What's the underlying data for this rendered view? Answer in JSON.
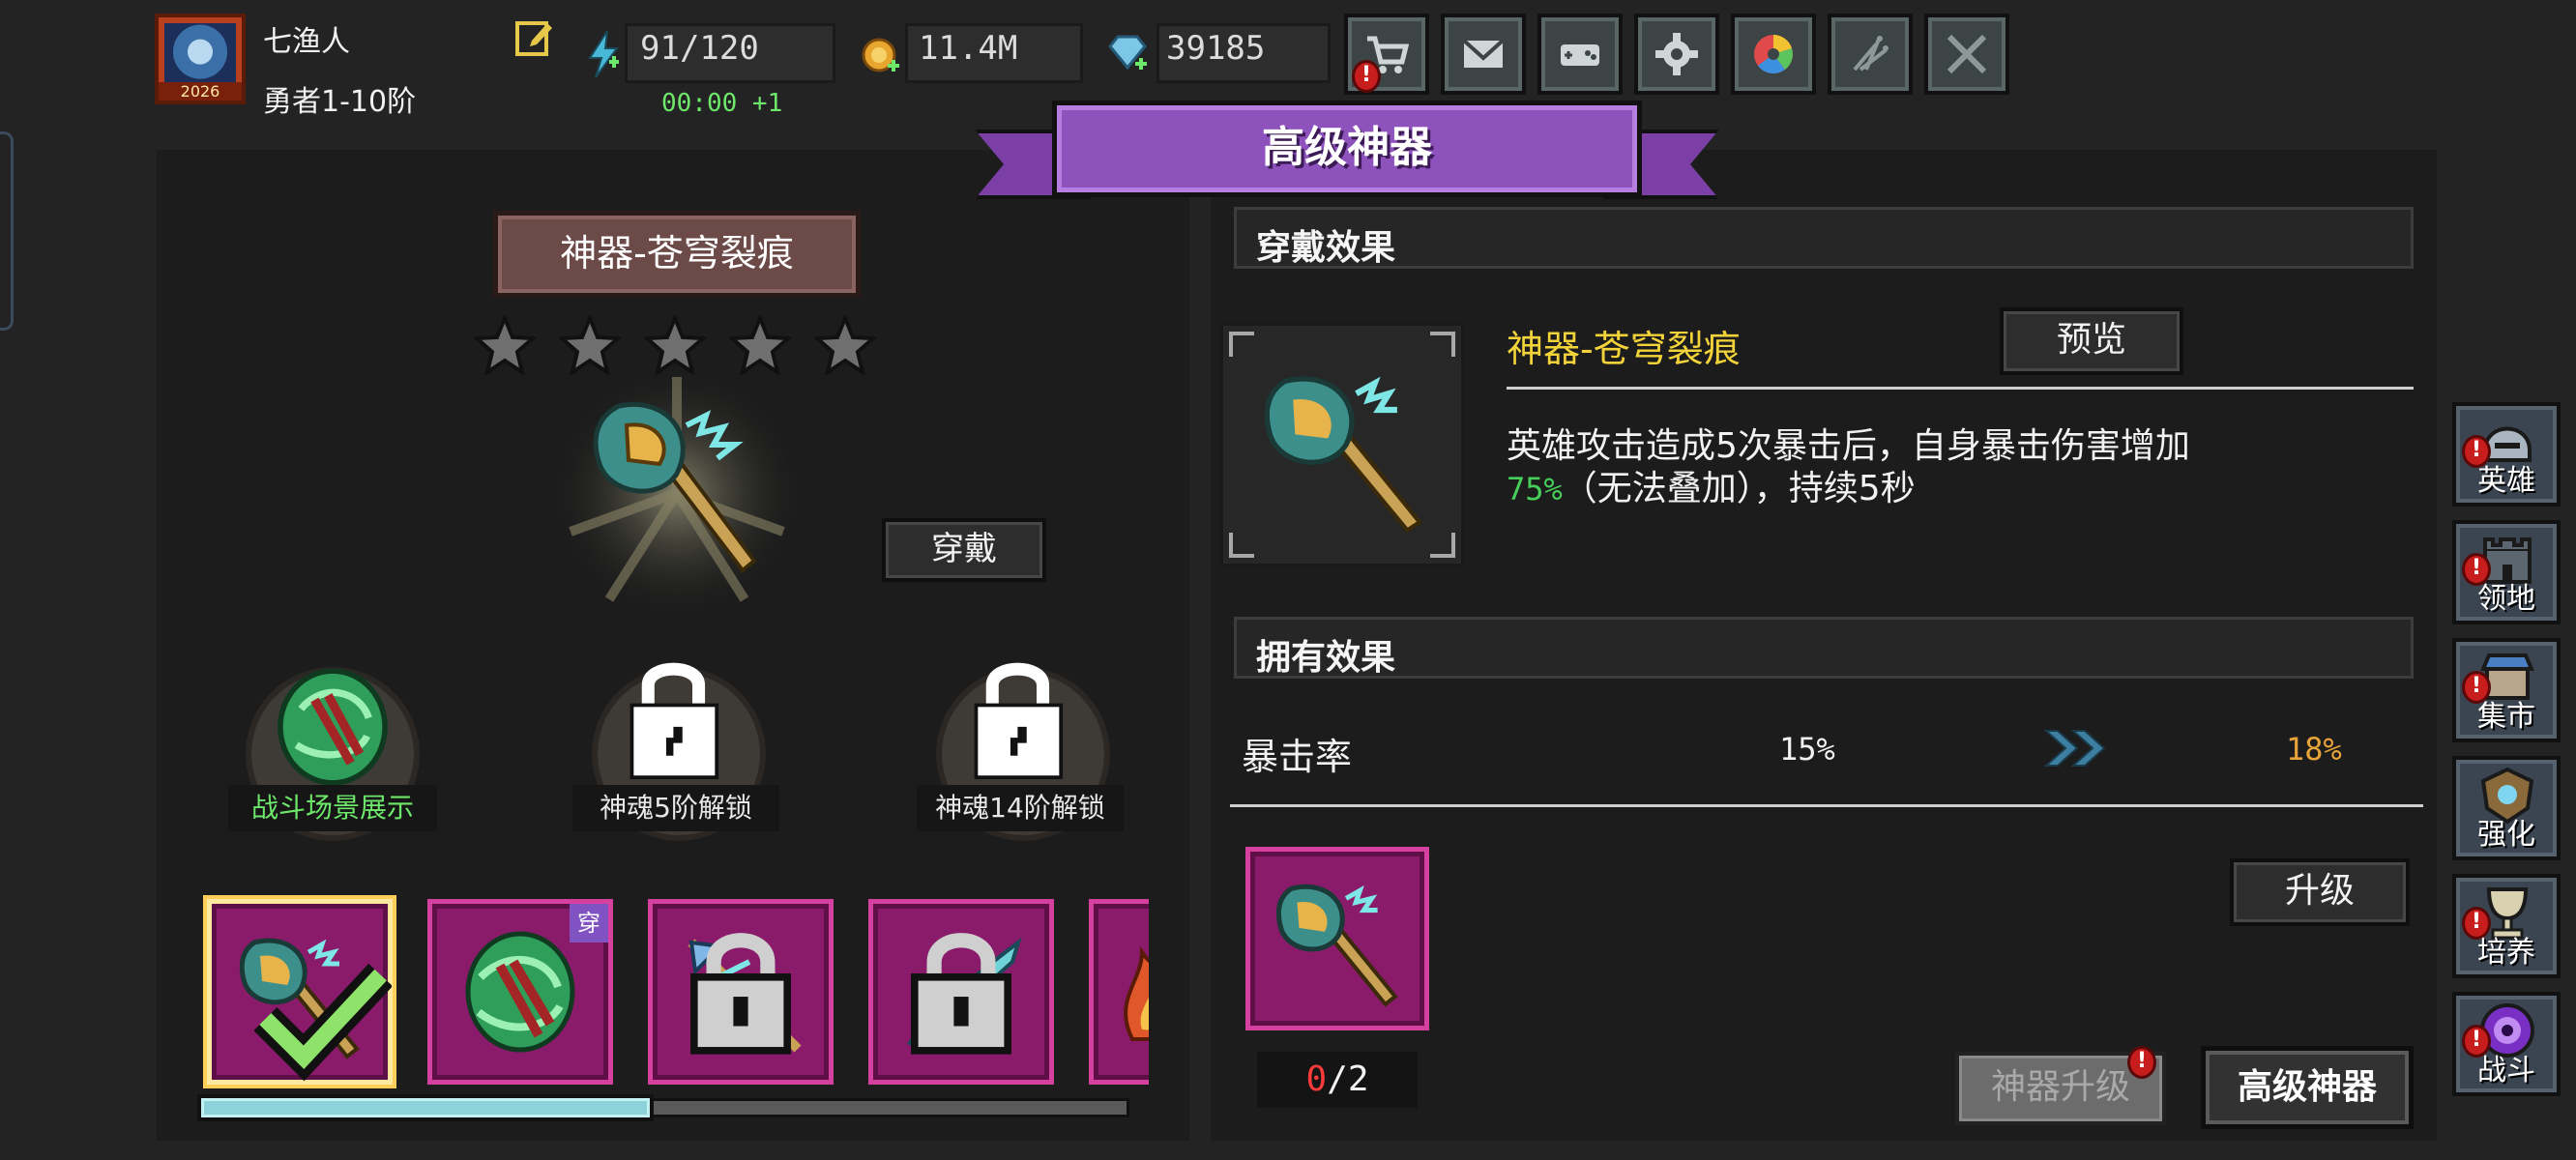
{
  "player": {
    "name": "七渔人",
    "rank": "勇者1-10阶",
    "avatar_year": "2026"
  },
  "resources": {
    "energy": "91/120",
    "energy_timer": "00:00 +1",
    "gold": "11.4M",
    "gems": "39185"
  },
  "toolbar": {
    "shop_alert": "!",
    "icons": [
      "cart-icon",
      "mail-icon",
      "gamepad-icon",
      "gear-icon",
      "color-wheel-icon",
      "fireworks-icon",
      "crossed-swords-icon"
    ]
  },
  "banner": {
    "title": "高级神器"
  },
  "artifact": {
    "title": "神器-苍穹裂痕",
    "stars_filled": 0,
    "stars_total": 5,
    "wear_label": "穿戴"
  },
  "slots": [
    {
      "label": "战斗场景展示",
      "label_color": "#6ee86b",
      "locked": false
    },
    {
      "label": "神魂5阶解锁",
      "label_color": "#f2f2f2",
      "locked": true
    },
    {
      "label": "神魂14阶解锁",
      "label_color": "#f2f2f2",
      "locked": true
    }
  ],
  "inventory": {
    "items": [
      {
        "name": "axe",
        "selected": true,
        "equipped_check": true
      },
      {
        "name": "green-orb",
        "wear_tag": "穿"
      },
      {
        "name": "trident",
        "locked": true
      },
      {
        "name": "blade",
        "locked": true
      },
      {
        "name": "fire",
        "partial": true
      }
    ],
    "scroll_fraction": 0.49
  },
  "wear_effect": {
    "header": "穿戴效果",
    "name": "神器-苍穹裂痕",
    "preview_label": "预览",
    "desc_line1": "英雄攻击造成5次暴击后，自身暴击伤害增加",
    "desc_highlight": "75%",
    "desc_line2_rest": "（无法叠加），持续5秒"
  },
  "own_effect": {
    "header": "拥有效果",
    "stat_name": "暴击率",
    "current": "15%",
    "next": "18%"
  },
  "upgrade": {
    "count_have": "0",
    "count_sep_need": "/2",
    "upgrade_label": "升级"
  },
  "bottom_tabs": {
    "artifact_upgrade": "神器升级",
    "advanced": "高级神器",
    "alert": "!"
  },
  "side_nav": [
    {
      "label": "英雄",
      "alert": "!"
    },
    {
      "label": "领地",
      "alert": "!"
    },
    {
      "label": "集市",
      "alert": "!"
    },
    {
      "label": "强化"
    },
    {
      "label": "培养",
      "alert": "!"
    },
    {
      "label": "战斗",
      "alert": "!"
    }
  ],
  "colors": {
    "accent_purple": "#8e52bd",
    "item_bg": "#8a1a6a",
    "item_border": "#d6409e",
    "gold_text": "#f3d33a",
    "green_text": "#46d05a",
    "orange_text": "#e8a43a"
  }
}
